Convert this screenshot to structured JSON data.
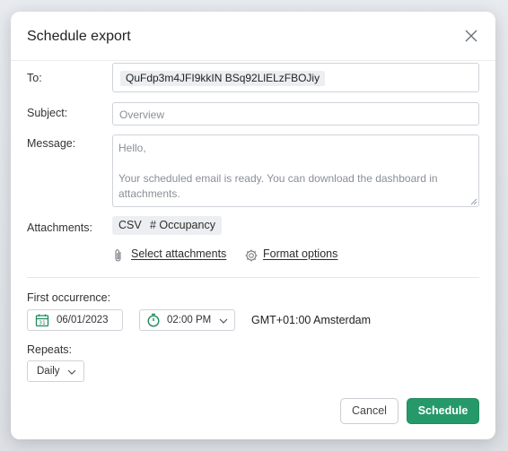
{
  "dialog": {
    "title": "Schedule export"
  },
  "form": {
    "to_label": "To:",
    "to_recipient": "QuFdp3m4JFI9kkIN BSq92LlELzFBOJiy",
    "subject_label": "Subject:",
    "subject_placeholder": "Overview",
    "message_label": "Message:",
    "message_greeting": "Hello,",
    "message_body": "Your scheduled email is ready. You can download the dashboard in attachments.",
    "attachments_label": "Attachments:",
    "attachment_format": "CSV",
    "attachment_name": "# Occupancy",
    "select_attachments": "Select attachments",
    "format_options": "Format options"
  },
  "schedule": {
    "first_occurrence_label": "First occurrence:",
    "date": "06/01/2023",
    "time": "02:00 PM",
    "timezone": "GMT+01:00 Amsterdam",
    "repeats_label": "Repeats:",
    "repeats_value": "Daily"
  },
  "actions": {
    "cancel": "Cancel",
    "schedule": "Schedule"
  },
  "colors": {
    "primary": "#26996a",
    "date_icon": "#1f8c5c"
  },
  "icons": {
    "close": "close-icon",
    "attachment": "paperclip-icon",
    "format": "gear-icon",
    "calendar": "calendar-icon",
    "clock": "clock-icon",
    "dropdown": "chevron-down-icon"
  }
}
